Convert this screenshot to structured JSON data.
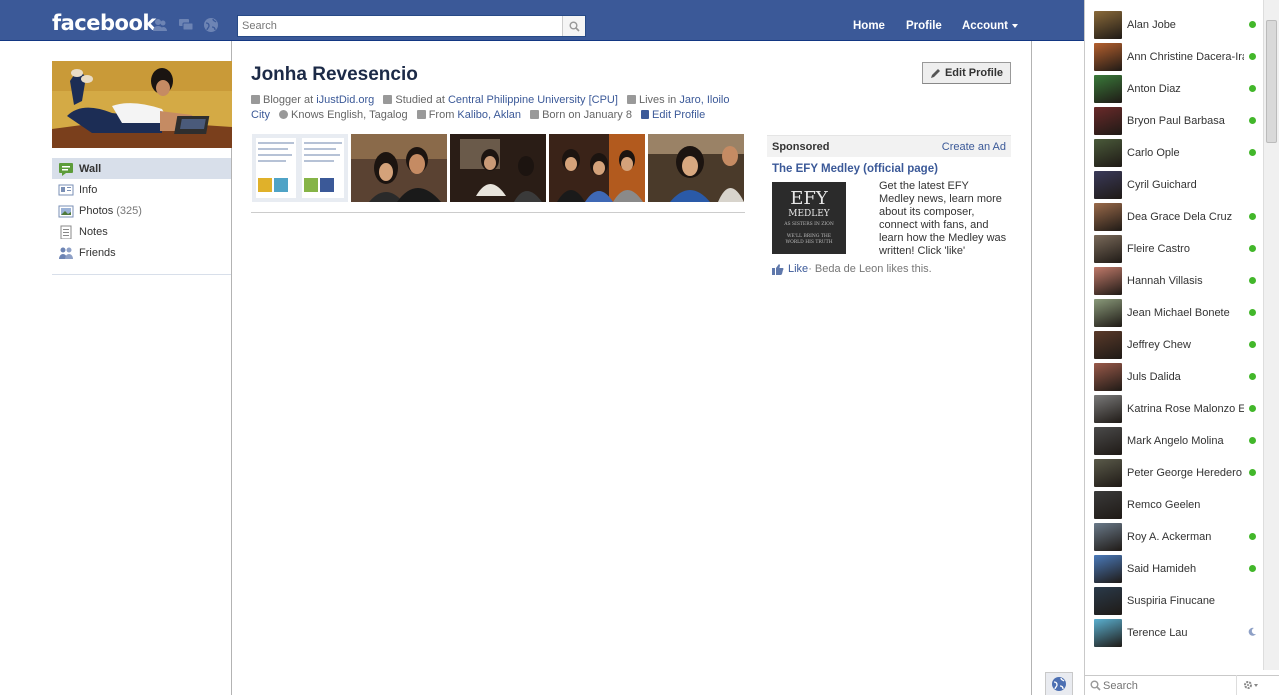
{
  "header": {
    "logo": "facebook",
    "search_placeholder": "Search",
    "nav": {
      "home": "Home",
      "profile": "Profile",
      "account": "Account"
    }
  },
  "profile": {
    "name": "Jonha Revesencio",
    "edit_profile_button": "Edit Profile",
    "info": {
      "blogger_prefix": "Blogger at",
      "blogger_link": "iJustDid.org",
      "studied_prefix": "Studied at",
      "studied_link": "Central Philippine University [CPU]",
      "lives_prefix": "Lives in",
      "lives_link": "Jaro, Iloilo City",
      "knows": "Knows English, Tagalog",
      "from_prefix": "From",
      "from_link": "Kalibo, Aklan",
      "born": "Born on January 8",
      "edit_link": "Edit Profile"
    }
  },
  "left_nav": {
    "items": [
      {
        "label": "Wall",
        "icon": "wall-icon",
        "count": ""
      },
      {
        "label": "Info",
        "icon": "info-icon",
        "count": ""
      },
      {
        "label": "Photos",
        "icon": "photos-icon",
        "count": "(325)"
      },
      {
        "label": "Notes",
        "icon": "notes-icon",
        "count": ""
      },
      {
        "label": "Friends",
        "icon": "friends-icon",
        "count": ""
      }
    ]
  },
  "sponsored": {
    "heading": "Sponsored",
    "create_ad": "Create an Ad",
    "ad_title": "The EFY Medley (official page)",
    "ad_image_text": {
      "line1": "EFY",
      "line2": "MEDLEY",
      "line3": "AS SISTERS IN ZION",
      "line4": "WE'LL BRING THE",
      "line5": "WORLD HIS TRUTH"
    },
    "ad_body": "Get the latest EFY Medley news, learn more about its composer, connect with fans, and learn how the Medley was written! Click 'like'",
    "like_label": "Like",
    "like_social": " · Beda de Leon likes this."
  },
  "chat": {
    "search_placeholder": "Search",
    "friends": [
      {
        "name": "Alan Jobe",
        "status": "online",
        "color": "#8a6a3a"
      },
      {
        "name": "Ann Christine Dacera-Ira",
        "status": "online",
        "color": "#b5602e"
      },
      {
        "name": "Anton Diaz",
        "status": "online",
        "color": "#3a7a3a"
      },
      {
        "name": "Bryon Paul Barbasa",
        "status": "online",
        "color": "#6a2a2a"
      },
      {
        "name": "Carlo Ople",
        "status": "online",
        "color": "#4a5a3a"
      },
      {
        "name": "Cyril Guichard",
        "status": "offline",
        "color": "#3a3a5a"
      },
      {
        "name": "Dea Grace Dela Cruz",
        "status": "online",
        "color": "#9a6a4a"
      },
      {
        "name": "Fleire Castro",
        "status": "online",
        "color": "#7a6a5a"
      },
      {
        "name": "Hannah Villasis",
        "status": "online",
        "color": "#c07a6a"
      },
      {
        "name": "Jean Michael Bonete",
        "status": "online",
        "color": "#8a9a7a"
      },
      {
        "name": "Jeffrey Chew",
        "status": "online",
        "color": "#5a3a2a"
      },
      {
        "name": "Juls Dalida",
        "status": "online",
        "color": "#9a5a4a"
      },
      {
        "name": "Katrina Rose Malonzo Es",
        "status": "online",
        "color": "#7a7a7a"
      },
      {
        "name": "Mark Angelo Molina",
        "status": "online",
        "color": "#4a4a4a"
      },
      {
        "name": "Peter George Heredero",
        "status": "online",
        "color": "#5a5a4a"
      },
      {
        "name": "Remco Geelen",
        "status": "offline",
        "color": "#3a3a3a"
      },
      {
        "name": "Roy A. Ackerman",
        "status": "online",
        "color": "#6a7a8a"
      },
      {
        "name": "Said Hamideh",
        "status": "online",
        "color": "#4a7aba"
      },
      {
        "name": "Suspiria Finucane",
        "status": "offline",
        "color": "#2a3a4a"
      },
      {
        "name": "Terence Lau",
        "status": "idle",
        "color": "#5ab0d0"
      }
    ]
  },
  "colors": {
    "brand_blue": "#3b5998",
    "online_green": "#42b72a"
  }
}
